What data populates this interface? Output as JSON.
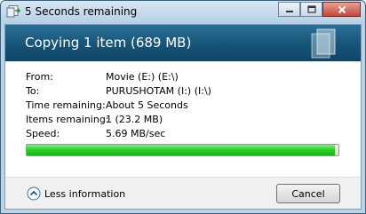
{
  "window": {
    "title": "5 Seconds remaining",
    "controls": {
      "minimize_icon": "minimize-icon",
      "maximize_icon": "maximize-icon",
      "close_icon": "close-icon"
    }
  },
  "header": {
    "title": "Copying 1 item (689 MB)",
    "icon": "copy-documents-icon"
  },
  "details": [
    {
      "label": "From:",
      "value": "Movie (E:) (E:\\)"
    },
    {
      "label": "To:",
      "value": "PURUSHOTAM (I:) (I:\\)"
    },
    {
      "label": "Time remaining:",
      "value": "About 5 Seconds"
    },
    {
      "label": "Items remaining:",
      "value": "1 (23.2 MB)"
    },
    {
      "label": "Speed:",
      "value": "5.69 MB/sec"
    }
  ],
  "progress": {
    "percent": 99
  },
  "footer": {
    "less_label": "Less information",
    "less_icon": "chevron-up-icon",
    "cancel_label": "Cancel"
  },
  "colors": {
    "progress_green": "#2fd02f",
    "header_blue": "#165478"
  }
}
